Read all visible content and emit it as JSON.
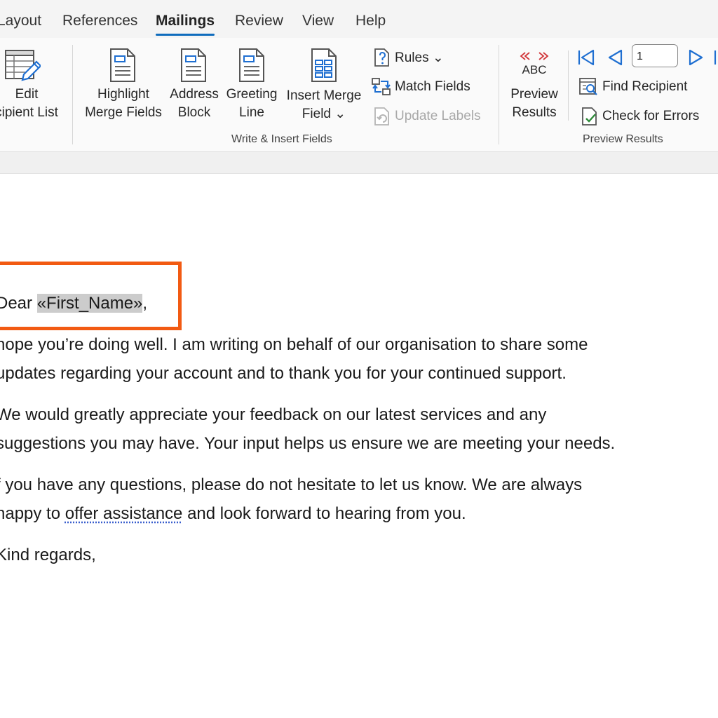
{
  "tabs": [
    {
      "label": "Layout",
      "name": "tab-layout"
    },
    {
      "label": "References",
      "name": "tab-references"
    },
    {
      "label": "Mailings",
      "name": "tab-mailings",
      "active": true
    },
    {
      "label": "Review",
      "name": "tab-review"
    },
    {
      "label": "View",
      "name": "tab-view"
    },
    {
      "label": "Help",
      "name": "tab-help"
    }
  ],
  "ribbon": {
    "edit_recipient_list": {
      "line1": "Edit",
      "line2": "cipient List"
    },
    "highlight_merge_fields": {
      "line1": "Highlight",
      "line2": "Merge Fields"
    },
    "address_block": {
      "line1": "Address",
      "line2": "Block"
    },
    "greeting_line": {
      "line1": "Greeting",
      "line2": "Line"
    },
    "insert_merge_field": {
      "line1": "Insert Merge",
      "line2": "Field ⌄"
    },
    "rules": "Rules ⌄",
    "match_fields": "Match Fields",
    "update_labels": "Update Labels",
    "write_insert_group": "Write & Insert Fields",
    "preview_abc": "ABC",
    "preview_results": {
      "line1": "Preview",
      "line2": "Results"
    },
    "record_number": "1",
    "find_recipient": "Find Recipient",
    "check_for_errors": "Check for Errors",
    "preview_results_group": "Preview Results"
  },
  "colors": {
    "accent": "#0f6cbd",
    "highlight_box": "#f25a12",
    "merge_field_bg": "#cccccc"
  },
  "document": {
    "greeting_prefix": "Dear ",
    "merge_field": "«First_Name»",
    "greeting_suffix": ",",
    "p1_line1": " hope you’re doing well. I am writing on behalf of our organisation to share some",
    "p1_line2": "updates regarding your account and to thank you for your continued support.",
    "p2_line1": "We would greatly appreciate your feedback on our latest services and any",
    "p2_line2": "suggestions you may have. Your input helps us ensure we are meeting your needs.",
    "p3_line1": "f you have any questions, please do not hesitate to let us know. We are always",
    "p3_line2_pre": "happy to ",
    "p3_line2_squiggle": "offer assistance",
    "p3_line2_post": " and look forward to hearing from you.",
    "closing": "Kind regards,"
  }
}
